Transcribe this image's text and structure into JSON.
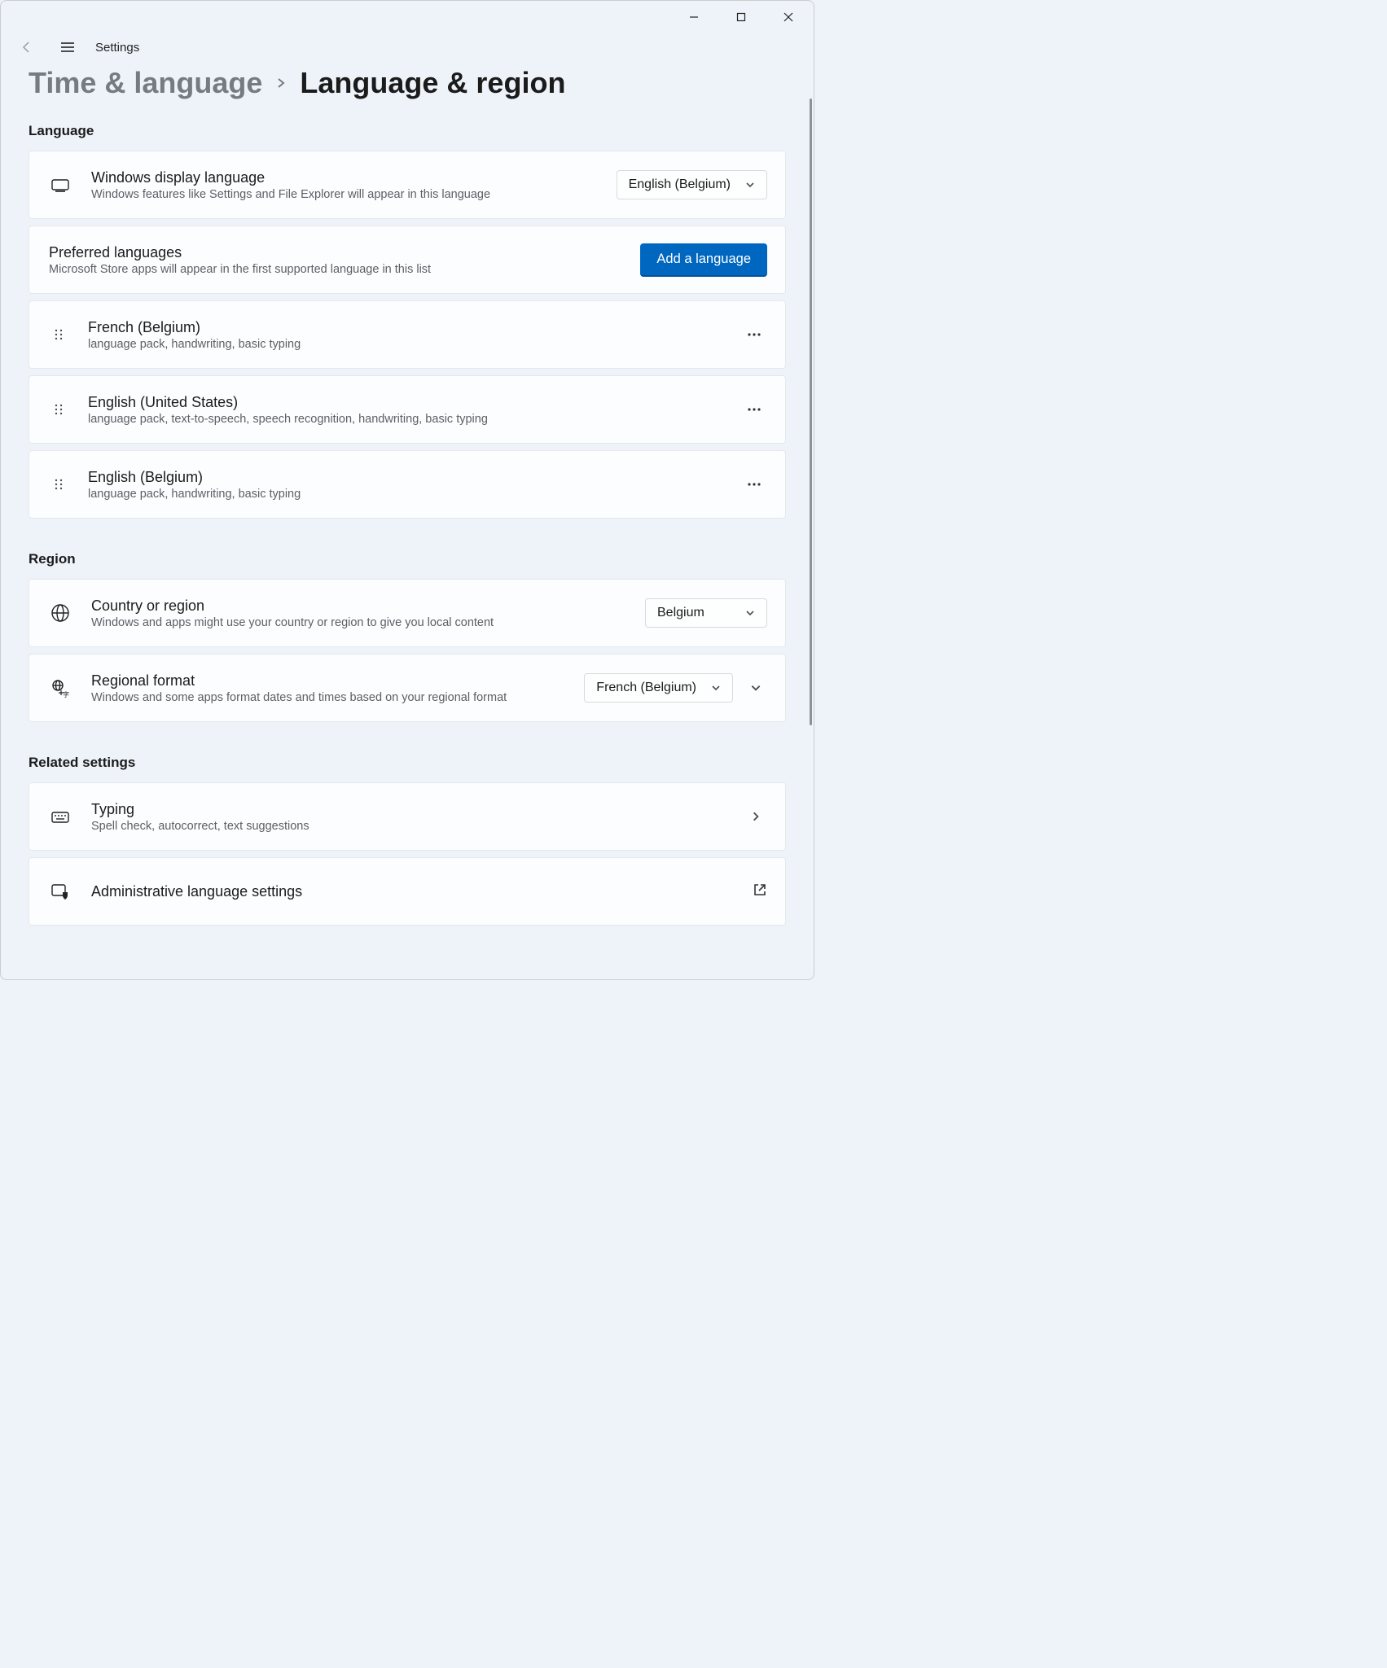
{
  "window": {
    "app_title": "Settings"
  },
  "breadcrumb": {
    "parent": "Time & language",
    "current": "Language & region"
  },
  "sections": {
    "language": {
      "title": "Language",
      "display_language": {
        "title": "Windows display language",
        "desc": "Windows features like Settings and File Explorer will appear in this language",
        "value": "English (Belgium)"
      },
      "preferred": {
        "title": "Preferred languages",
        "desc": "Microsoft Store apps will appear in the first supported language in this list",
        "add_button": "Add a language"
      },
      "langs": [
        {
          "name": "French (Belgium)",
          "desc": "language pack, handwriting, basic typing"
        },
        {
          "name": "English (United States)",
          "desc": "language pack, text-to-speech, speech recognition, handwriting, basic typing"
        },
        {
          "name": "English (Belgium)",
          "desc": "language pack, handwriting, basic typing"
        }
      ]
    },
    "region": {
      "title": "Region",
      "country": {
        "title": "Country or region",
        "desc": "Windows and apps might use your country or region to give you local content",
        "value": "Belgium"
      },
      "format": {
        "title": "Regional format",
        "desc": "Windows and some apps format dates and times based on your regional format",
        "value": "French (Belgium)"
      }
    },
    "related": {
      "title": "Related settings",
      "typing": {
        "title": "Typing",
        "desc": "Spell check, autocorrect, text suggestions"
      },
      "admin": {
        "title": "Administrative language settings"
      }
    }
  }
}
